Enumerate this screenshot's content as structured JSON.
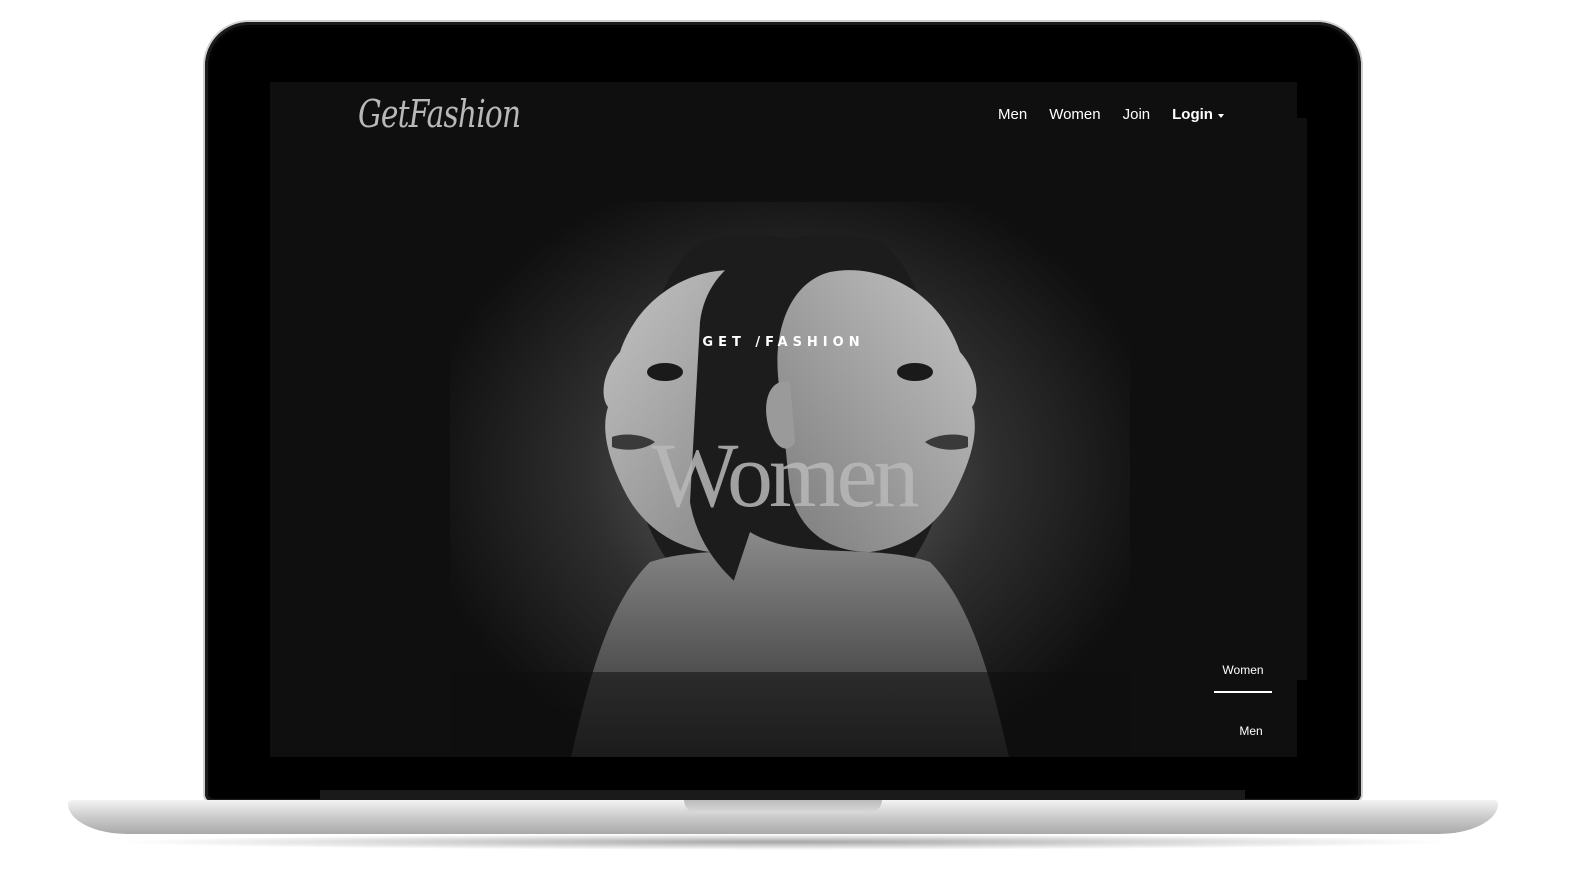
{
  "site": {
    "logo": "GetFashion"
  },
  "nav": {
    "items": [
      {
        "label": "Men"
      },
      {
        "label": "Women"
      },
      {
        "label": "Join"
      }
    ],
    "login_label": "Login"
  },
  "hero": {
    "eyebrow": "GET /FASHION",
    "title": "Women"
  },
  "slider": {
    "tabs": [
      {
        "label": "Women",
        "active": true
      },
      {
        "label": "Men",
        "active": false
      }
    ]
  },
  "colors": {
    "background": "#0f0f0f",
    "text": "#ffffff",
    "title": "#b9b9b9"
  }
}
